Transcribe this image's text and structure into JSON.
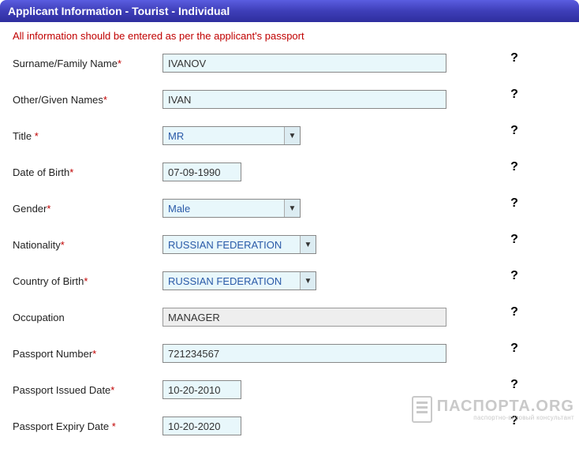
{
  "header": {
    "title": "Applicant Information - Tourist - Individual"
  },
  "notice": "All information should be entered as per the applicant's passport",
  "help_glyph": "?",
  "fields": {
    "surname": {
      "label": "Surname/Family Name",
      "required": true,
      "type": "text-wide",
      "value": "IVANOV"
    },
    "other_names": {
      "label": "Other/Given Names",
      "required": true,
      "type": "text-wide",
      "value": "IVAN"
    },
    "title": {
      "label": "Title ",
      "required": true,
      "type": "select-w1",
      "value": "MR"
    },
    "dob": {
      "label": "Date of Birth",
      "required": true,
      "type": "text-short",
      "value": "07-09-1990"
    },
    "gender": {
      "label": "Gender",
      "required": true,
      "type": "select-w1",
      "value": "Male"
    },
    "nationality": {
      "label": "Nationality",
      "required": true,
      "type": "select-w2",
      "value": "RUSSIAN FEDERATION"
    },
    "cob": {
      "label": "Country of Birth",
      "required": true,
      "type": "select-w2",
      "value": "RUSSIAN FEDERATION"
    },
    "occupation": {
      "label": "Occupation",
      "required": false,
      "type": "gray-wide",
      "value": "MANAGER"
    },
    "passport_no": {
      "label": "Passport Number",
      "required": true,
      "type": "text-wide",
      "value": "721234567"
    },
    "passport_issue": {
      "label": "Passport Issued Date",
      "required": true,
      "type": "text-short",
      "value": "10-20-2010"
    },
    "passport_expiry": {
      "label": "Passport Expiry Date ",
      "required": true,
      "type": "text-short",
      "value": "10-20-2020"
    }
  },
  "watermark": {
    "main": "ПАСПОРТА.ORG",
    "sub": "паспортно-визовый консультант"
  }
}
